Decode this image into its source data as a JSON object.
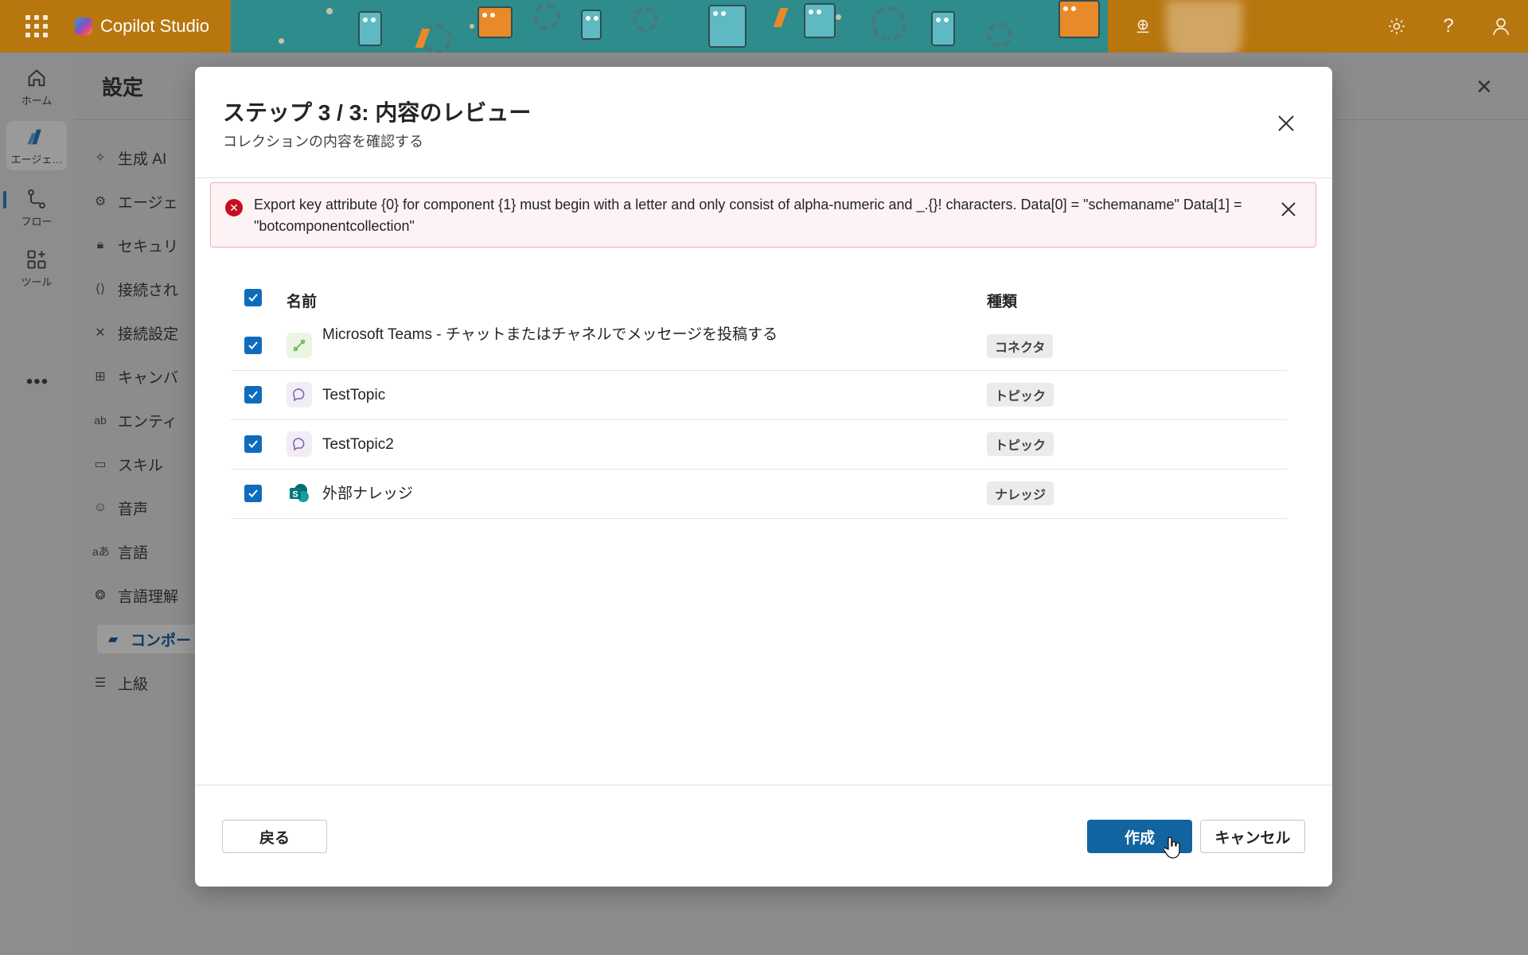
{
  "app": {
    "title": "Copilot Studio"
  },
  "rail": {
    "items": [
      {
        "label": "ホーム",
        "icon": "home-icon"
      },
      {
        "label": "エージェ…",
        "icon": "agents-icon"
      },
      {
        "label": "フロー",
        "icon": "flow-icon"
      },
      {
        "label": "ツール",
        "icon": "tools-icon"
      }
    ],
    "more": "•••"
  },
  "settings": {
    "title": "設定",
    "nav": [
      {
        "label": "生成 AI",
        "icon": "sparkle-icon"
      },
      {
        "label": "エージェ",
        "icon": "gear-icon"
      },
      {
        "label": "セキュリ",
        "icon": "lock-icon"
      },
      {
        "label": "接続され",
        "icon": "connection-icon"
      },
      {
        "label": "接続設定",
        "icon": "network-icon"
      },
      {
        "label": "キャンバ",
        "icon": "grid-icon"
      },
      {
        "label": "エンティ",
        "icon": "entity-icon"
      },
      {
        "label": "スキル",
        "icon": "briefcase-icon"
      },
      {
        "label": "音声",
        "icon": "voice-icon"
      },
      {
        "label": "言語",
        "icon": "language-icon"
      },
      {
        "label": "言語理解",
        "icon": "brain-icon"
      },
      {
        "label": "コンポー",
        "icon": "component-icon"
      },
      {
        "label": "上級",
        "icon": "sliders-icon"
      }
    ]
  },
  "modal": {
    "title": "ステップ 3 / 3: 内容のレビュー",
    "subtitle": "コレクションの内容を確認する",
    "error": "Export key attribute {0} for component {1} must begin with a letter and only consist of alpha-numeric and _.{}! characters. Data[0] = \"schemaname\" Data[1] = \"botcomponentcollection\"",
    "table": {
      "col_name": "名前",
      "col_type": "種類",
      "rows": [
        {
          "name": "Microsoft Teams - チャットまたはチャネルでメッセージを投稿する",
          "type": "コネクタ",
          "icon": "connector-icon"
        },
        {
          "name": "TestTopic",
          "type": "トピック",
          "icon": "topic-icon"
        },
        {
          "name": "TestTopic2",
          "type": "トピック",
          "icon": "topic-icon"
        },
        {
          "name": "外部ナレッジ",
          "type": "ナレッジ",
          "icon": "sharepoint-icon"
        }
      ]
    },
    "buttons": {
      "back": "戻る",
      "create": "作成",
      "cancel": "キャンセル"
    }
  },
  "colors": {
    "accent": "#0f6cbd",
    "error": "#c50f1f",
    "header": "#b8760f"
  }
}
